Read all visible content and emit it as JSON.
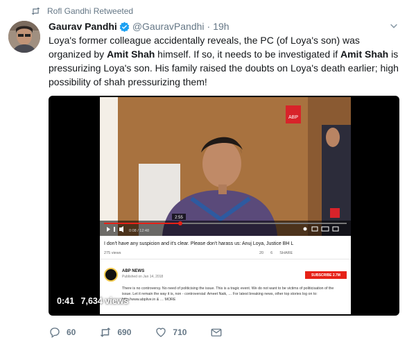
{
  "retweet": {
    "label": "Rofl Gandhi Retweeted",
    "icon": "retweet-icon"
  },
  "author": {
    "name": "Gaurav Pandhi",
    "handle": "@GauravPandhi",
    "dot": "·",
    "time": "19h",
    "verified_icon": "verified-badge-icon"
  },
  "tweet": {
    "text_1": "Loya's former colleague accidentally reveals, the PC (of Loya's son) was organized by ",
    "bold_1": "Amit Shah",
    "text_2": " himself. If so, it needs to be investigated if ",
    "bold_2": "Amit Shah",
    "text_3": " is pressurizing Loya's son. His family raised the doubts on Loya's death earlier; high possibility of shah pressurizing them!"
  },
  "video": {
    "elapsed": "0:41",
    "views": "7,634 views",
    "embedded_page": {
      "video_title": "I don't have any suspicion and it's clear. Please don't harass us: Anuj Loya, Justice BH L",
      "views": "275 views",
      "likes": "20",
      "dislikes": "6",
      "share_label": "SHARE",
      "current_time": "2:55",
      "duration": "0:08 / 12:48",
      "channel_name": "ABP NEWS",
      "published": "Published on Jan 14, 2018",
      "subscribe_label": "SUBSCRIBE 2.7M",
      "description": "There is no controversy. No need of politicising the issue. This is a tragic event. We do not want to be victims of politicisation of the issue. Let it remain the way it is, non - controversial: Ameet Naik, … For latest breaking news, other top stories log on to: http://www.abplive.in & … MORE"
    }
  },
  "actions": {
    "reply_count": "60",
    "retweet_count": "690",
    "like_count": "710"
  },
  "colors": {
    "muted": "#657786",
    "verified": "#1da1f2",
    "text": "#14171a",
    "youtube_red": "#e62117"
  }
}
